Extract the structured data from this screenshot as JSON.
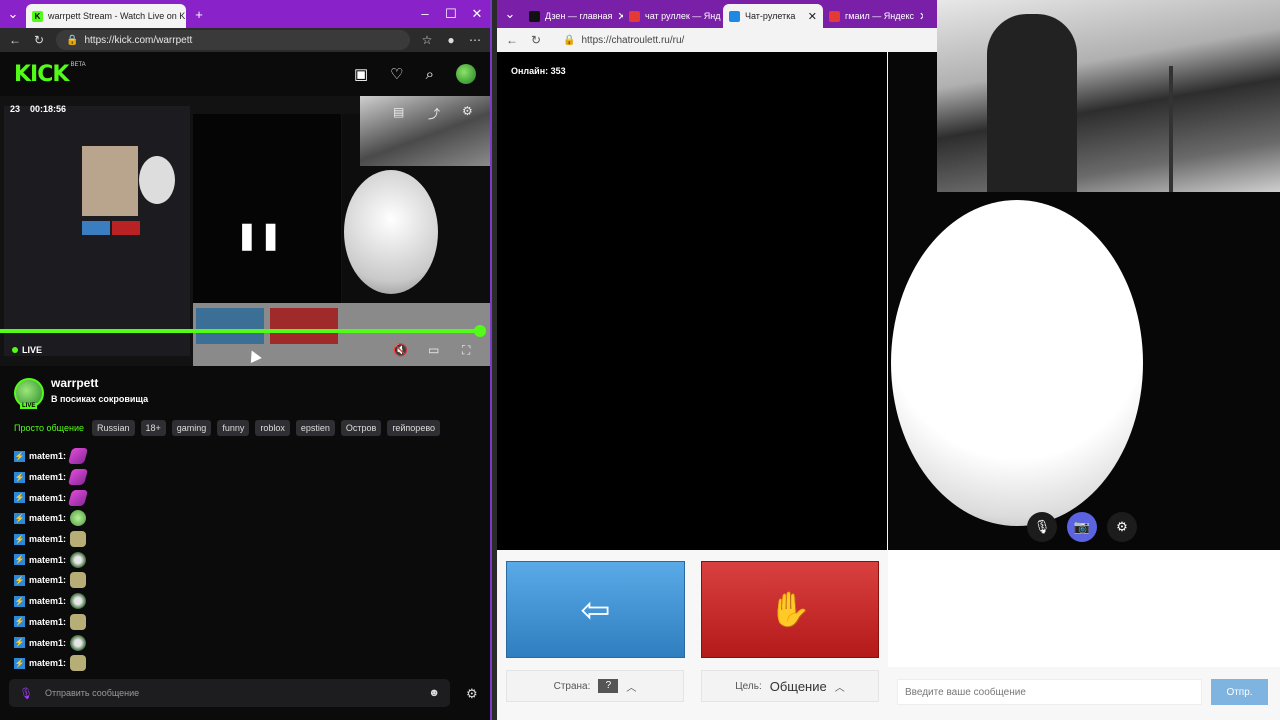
{
  "left_window": {
    "tab_title": "warrpett Stream - Watch Live on K",
    "url": "https://kick.com/warrpett",
    "kick": {
      "logo": "KICK",
      "logo_badge": "BETA",
      "header_icons": [
        "tv-icon",
        "heart-icon",
        "search-icon",
        "avatar"
      ]
    },
    "video": {
      "viewers": "23",
      "duration": "00:18:56",
      "live_label": "LIVE",
      "progress": 1.0
    },
    "channel": {
      "name": "warrpett",
      "stream_title": "В посиках сокровища",
      "avatar_badge": "LIVE",
      "category": "Просто общение",
      "tags": [
        "Russian",
        "18+",
        "gaming",
        "funny",
        "roblox",
        "epstien",
        "Остров",
        "гейпорево"
      ]
    },
    "chat": {
      "messages": [
        {
          "user": "matem1:",
          "emote": "pink"
        },
        {
          "user": "matem1:",
          "emote": "pink"
        },
        {
          "user": "matem1:",
          "emote": "pink"
        },
        {
          "user": "matem1:",
          "emote": "green"
        },
        {
          "user": "matem1:",
          "emote": "tan"
        },
        {
          "user": "matem1:",
          "emote": "face"
        },
        {
          "user": "matem1:",
          "emote": "tan"
        },
        {
          "user": "matem1:",
          "emote": "face"
        },
        {
          "user": "matem1:",
          "emote": "tan"
        },
        {
          "user": "matem1:",
          "emote": "face"
        },
        {
          "user": "matem1:",
          "emote": "tan"
        }
      ],
      "input_placeholder": "Отправить сообщение"
    },
    "tab_favicon_color": "#53fc18"
  },
  "right_window": {
    "tabs": [
      {
        "title": "Дзен — главная",
        "favicon_color": "#111111",
        "active": false
      },
      {
        "title": "чат руллек — Янд",
        "favicon_color": "#e53935",
        "active": false
      },
      {
        "title": "Чат-рулетка",
        "favicon_color": "#1e88e5",
        "active": true
      },
      {
        "title": "гмаил — Яндекс",
        "favicon_color": "#e53935",
        "active": false
      }
    ],
    "url": "https://chatroulett.ru/ru/",
    "online": "Онлайн: 353",
    "country_label": "Страна:",
    "country_value": "?",
    "goal_label": "Цель:",
    "goal_value": "Общение",
    "message_placeholder": "Введите ваше сообщение",
    "send_label": "Отпр.",
    "colors": {
      "next": "#3f92d4",
      "stop": "#c62828",
      "accent": "#5b63e0"
    }
  }
}
